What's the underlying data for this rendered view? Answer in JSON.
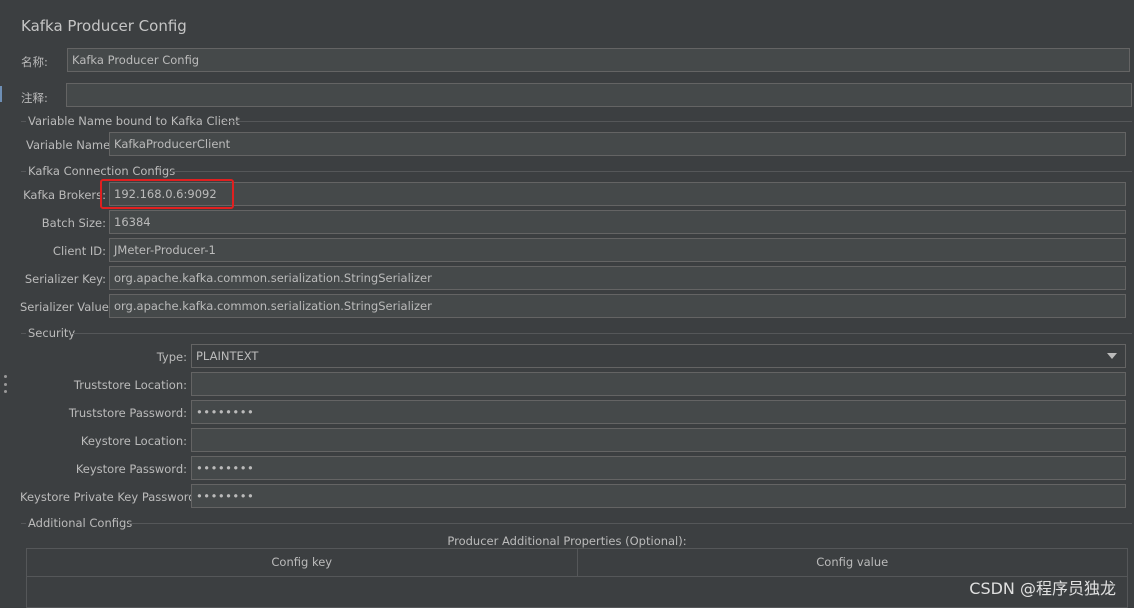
{
  "panel": {
    "title": "Kafka Producer Config",
    "name_label": "名称:",
    "name_value": "Kafka Producer Config",
    "comment_label": "注释:",
    "comment_value": ""
  },
  "variable_section": {
    "title": "Variable Name bound to Kafka Client",
    "variable_label": "Variable Name:",
    "variable_value": "KafkaProducerClient"
  },
  "connection_section": {
    "title": "Kafka Connection Configs",
    "broker_label": "Kafka Brokers:",
    "broker_value": "192.168.0.6:9092",
    "batch_label": "Batch Size:",
    "batch_value": "16384",
    "client_label": "Client ID:",
    "client_value": "JMeter-Producer-1",
    "ser_key_label": "Serializer Key:",
    "ser_key_value": "org.apache.kafka.common.serialization.StringSerializer",
    "ser_val_label": "Serializer Value:",
    "ser_val_value": "org.apache.kafka.common.serialization.StringSerializer"
  },
  "security_section": {
    "title": "Security",
    "type_label": "Type:",
    "type_value": "PLAINTEXT",
    "truststore_loc_label": "Truststore Location:",
    "truststore_loc_value": "",
    "truststore_pw_label": "Truststore Password:",
    "truststore_pw_value": "••••••••",
    "keystore_loc_label": "Keystore Location:",
    "keystore_loc_value": "",
    "keystore_pw_label": "Keystore Password:",
    "keystore_pw_value": "••••••••",
    "key_pw_label": "Keystore Private Key Password:",
    "key_pw_value": "••••••••"
  },
  "additional_section": {
    "title": "Additional Configs",
    "table_title": "Producer Additional Properties (Optional):",
    "columns": [
      "Config key",
      "Config value"
    ]
  },
  "watermark": "CSDN @程序员独龙",
  "colors": {
    "background": "#3c3f41",
    "field_bg": "#45494a",
    "highlight": "#e02020"
  }
}
